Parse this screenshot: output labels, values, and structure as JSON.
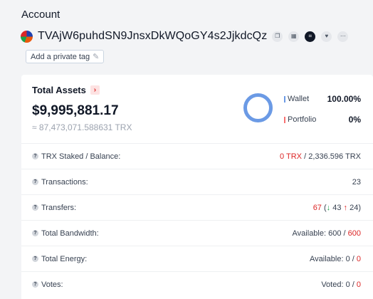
{
  "header": {
    "title": "Account",
    "address": "TVAjW6puhdSN9JnsxDkWQoGY4s2JjkdcQz",
    "icons": [
      "copy-icon",
      "qr-code-icon",
      "explorer-icon",
      "favorite-icon",
      "more-icon"
    ]
  },
  "private_tag": {
    "label": "Add a private tag"
  },
  "total_assets": {
    "title": "Total Assets",
    "usd_value": "$9,995,881.17",
    "trx_value": "≈ 87,473,071.588631 TRX",
    "wallet": {
      "label": "Wallet",
      "percent": "100.00%",
      "fraction": 1.0
    },
    "portfolio": {
      "label": "Portfolio",
      "percent": "0%",
      "fraction": 0.0
    },
    "colors": {
      "wallet": "#6b9ae5",
      "portfolio": "#f87171"
    }
  },
  "rows": {
    "staked": {
      "label": "TRX Staked / Balance:",
      "staked": "0 TRX",
      "sep": " / ",
      "balance": "2,336.596 TRX"
    },
    "transactions": {
      "label": "Transactions:",
      "value": "23"
    },
    "transfers": {
      "label": "Transfers:",
      "total": "67",
      "open": " (",
      "in_arrow": "↓",
      "in_count": " 43 ",
      "out_arrow": "↑",
      "out_count": " 24",
      "close": ")"
    },
    "bandwidth": {
      "label": "Total Bandwidth:",
      "prefix": "Available: ",
      "available": "600",
      "sep": " / ",
      "total": "600"
    },
    "energy": {
      "label": "Total Energy:",
      "prefix": "Available: ",
      "available": "0",
      "sep": " / ",
      "total": "0"
    },
    "votes": {
      "label": "Votes:",
      "prefix": "Voted: ",
      "voted": "0",
      "sep": " / ",
      "total": "0"
    }
  }
}
